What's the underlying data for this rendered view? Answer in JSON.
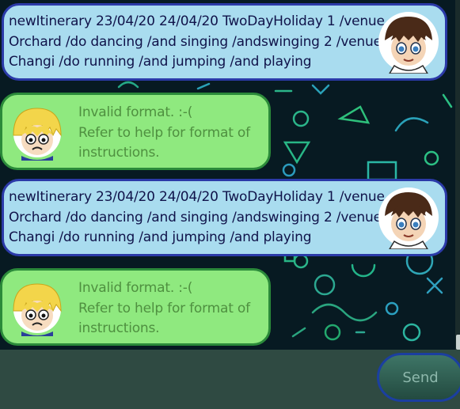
{
  "messages": [
    {
      "sender": "user",
      "lines": [
        "newItinerary 23/04/20 24/04/20 TwoDayHoliday 1 /venue",
        "Orchard /do dancing /and singing /andswinging 2 /venue",
        "Changi /do running /and jumping /and playing"
      ]
    },
    {
      "sender": "bot",
      "lines": [
        "Invalid format. :-(",
        "Refer to help for format of",
        "instructions."
      ]
    },
    {
      "sender": "user",
      "lines": [
        "newItinerary 23/04/20 24/04/20 TwoDayHoliday 1 /venue",
        "Orchard /do dancing /and singing /andswinging 2 /venue",
        "Changi /do running /and jumping /and playing"
      ]
    },
    {
      "sender": "bot",
      "lines": [
        "Invalid format. :-(",
        "Refer to help for format of",
        "instructions."
      ]
    }
  ],
  "input": {
    "value": "",
    "placeholder": ""
  },
  "send_label": "Send",
  "icons": {
    "user_avatar": "user-avatar-icon",
    "bot_avatar": "bot-avatar-icon"
  },
  "colors": {
    "user_bubble": "#a9dcef",
    "user_border": "#2b3aa8",
    "bot_bubble": "#8fe97f",
    "bot_border": "#2b8a3a",
    "bot_text": "#4f9040",
    "user_text": "#10134a",
    "chat_background": "#071a22",
    "composer_background": "#2f4a42"
  }
}
